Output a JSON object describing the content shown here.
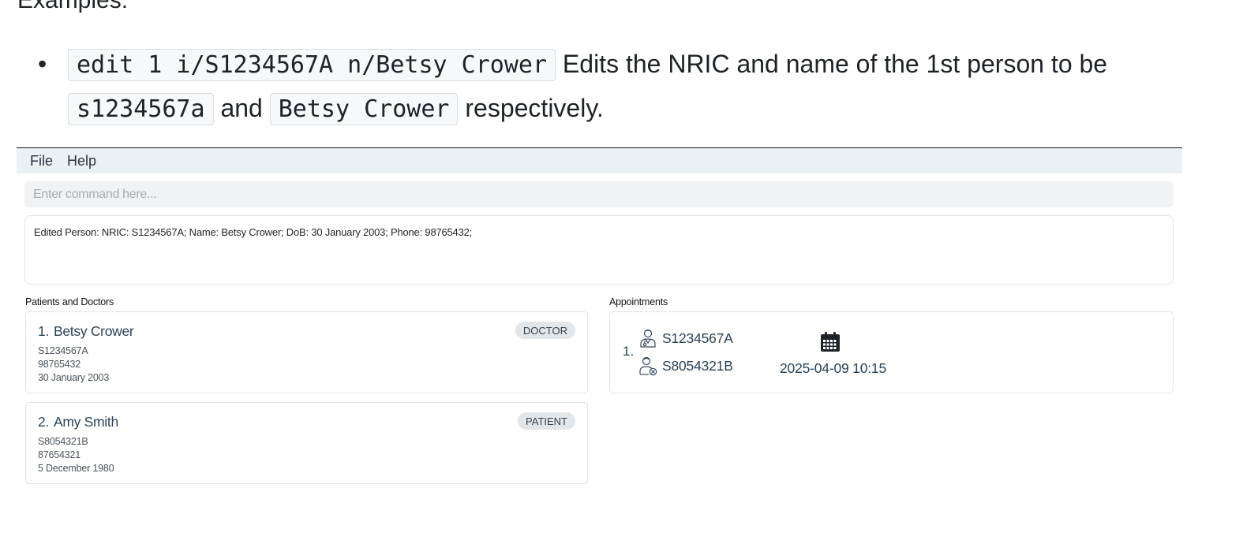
{
  "doc": {
    "heading": "Examples:",
    "bullet": {
      "code1": "edit 1 i/S1234567A n/Betsy Crower",
      "text1": " Edits the NRIC and name of the 1st person to be ",
      "code2": "s1234567a",
      "text2": " and ",
      "code3": "Betsy Crower",
      "text3": " respectively."
    }
  },
  "menu": {
    "file": "File",
    "help": "Help"
  },
  "command": {
    "placeholder": "Enter command here..."
  },
  "result": {
    "text": "Edited Person: NRIC: S1234567A; Name: Betsy Crower; DoB: 30 January 2003; Phone: 98765432;"
  },
  "persons_panel": {
    "title": "Patients and Doctors",
    "persons": [
      {
        "index": "1.",
        "name": "Betsy Crower",
        "nric": "S1234567A",
        "phone": "98765432",
        "dob": "30 January 2003",
        "role": "DOCTOR"
      },
      {
        "index": "2.",
        "name": "Amy Smith",
        "nric": "S8054321B",
        "phone": "87654321",
        "dob": "5 December 1980",
        "role": "PATIENT"
      }
    ]
  },
  "appointments_panel": {
    "title": "Appointments",
    "appointments": [
      {
        "index": "1.",
        "doctor_nric": "S1234567A",
        "patient_nric": "S8054321B",
        "datetime": "2025-04-09 10:15",
        "doctor_icon": "doctor-icon",
        "patient_icon": "patient-icon",
        "date_icon": "calendar-icon"
      }
    ]
  }
}
